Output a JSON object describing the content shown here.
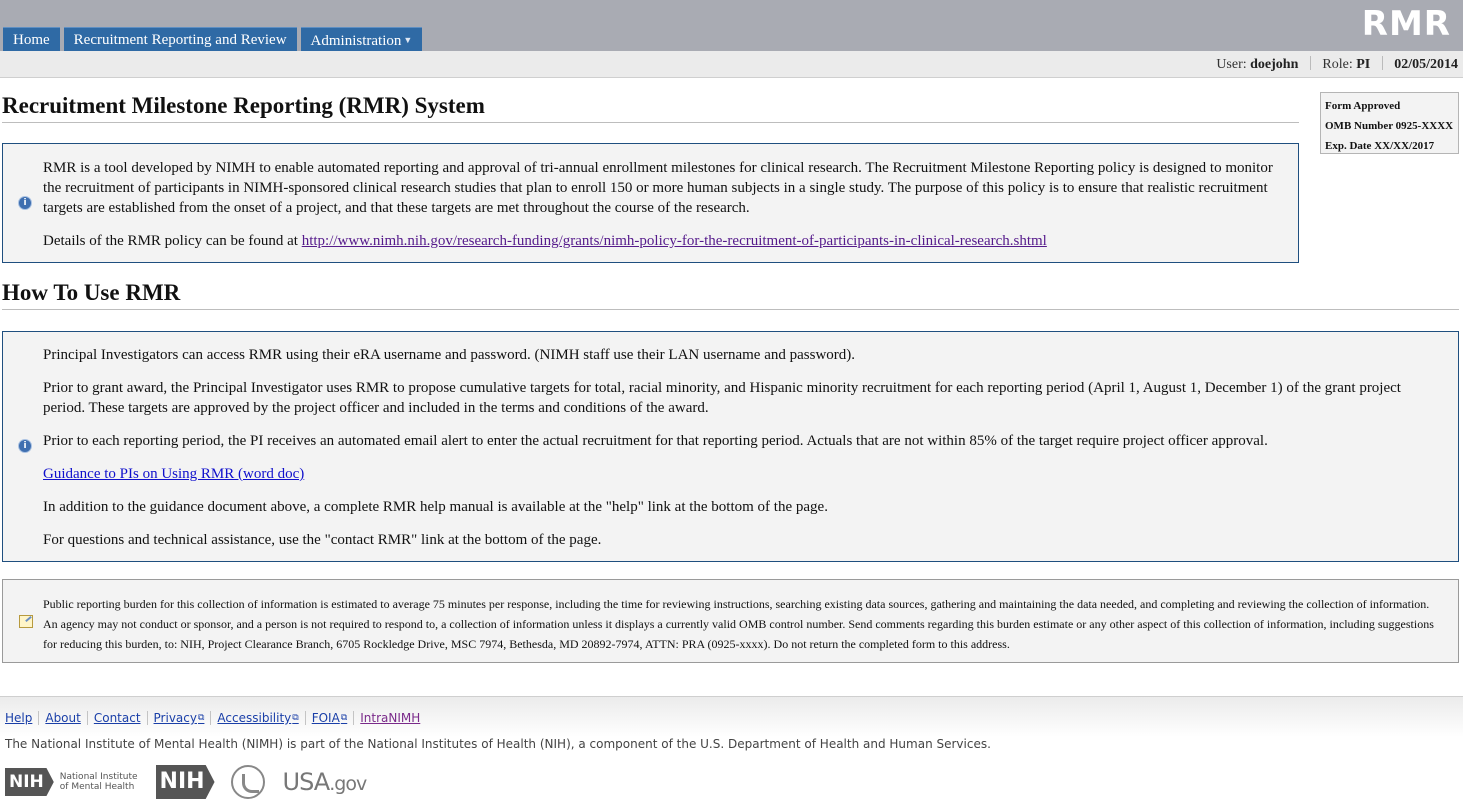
{
  "app": {
    "logo": "RMR"
  },
  "nav": [
    {
      "label": "Home"
    },
    {
      "label": "Recruitment Reporting and Review"
    },
    {
      "label": "Administration"
    }
  ],
  "userbar": {
    "user_label": "User:",
    "user": "doejohn",
    "role_label": "Role:",
    "role": "PI",
    "date": "02/05/2014"
  },
  "omb": {
    "line1": "Form Approved",
    "line2": "OMB Number 0925-XXXX",
    "line3": "Exp. Date XX/XX/2017"
  },
  "page_title": "Recruitment Milestone Reporting (RMR) System",
  "intro": {
    "text": "RMR is a tool developed by NIMH to enable automated reporting and approval of tri-annual enrollment milestones for clinical research. The Recruitment Milestone Reporting policy is designed to monitor the recruitment of participants in NIMH-sponsored clinical research studies that plan to enroll 150 or more human subjects in a single study. The purpose of this policy is to ensure that realistic recruitment targets are established from the onset of a project, and that these targets are met throughout the course of the research.",
    "details_prefix": "Details of the RMR policy can be found at ",
    "details_link": "http://www.nimh.nih.gov/research-funding/grants/nimh-policy-for-the-recruitment-of-participants-in-clinical-research.shtml"
  },
  "how_to": {
    "heading": "How To Use RMR",
    "p1": "Principal Investigators can access RMR using their eRA username and password. (NIMH staff use their LAN username and password).",
    "p2": "Prior to grant award, the Principal Investigator uses RMR to propose cumulative targets for total, racial minority, and Hispanic minority recruitment for each reporting period (April 1, August 1, December 1) of the grant project period. These targets are approved by the project officer and included in the terms and conditions of the award.",
    "p3": "Prior to each reporting period, the PI receives an automated email alert to enter the actual recruitment for that reporting period. Actuals that are not within 85% of the target require project officer approval.",
    "guidance_link": "Guidance to PIs on Using RMR (word doc)",
    "p4": "In addition to the guidance document above, a complete RMR help manual is available at the \"help\" link at the bottom of the page.",
    "p5": "For questions and technical assistance, use the \"contact RMR\" link at the bottom of the page."
  },
  "burden": {
    "text": "Public reporting burden for this collection of information is estimated to average 75 minutes per response, including the time for reviewing instructions, searching existing data sources, gathering and maintaining the data needed, and completing and reviewing the collection of information. An agency may not conduct or sponsor, and a person is not required to respond to, a collection of information unless it displays a currently valid OMB control number. Send comments regarding this burden estimate or any other aspect of this collection of information, including suggestions for reducing this burden, to: NIH, Project Clearance Branch, 6705 Rockledge Drive, MSC 7974, Bethesda, MD 20892-7974, ATTN: PRA (0925-xxxx). Do not return the completed form to this address."
  },
  "footer": {
    "links": {
      "help": "Help",
      "about": "About",
      "contact": "Contact",
      "privacy": "Privacy",
      "accessibility": "Accessibility",
      "foia": "FOIA",
      "intranimh": "IntraNIMH"
    },
    "text": "The National Institute of Mental Health (NIMH) is part of the National Institutes of Health (NIH), a component of the U.S. Department of Health and Human Services.",
    "logos": {
      "nih_mark": "NIH",
      "nimh_line1": "National Institute",
      "nimh_line2": "of Mental Health",
      "nih_mark2": "NIH",
      "usa": "USA",
      "gov": ".gov"
    }
  }
}
